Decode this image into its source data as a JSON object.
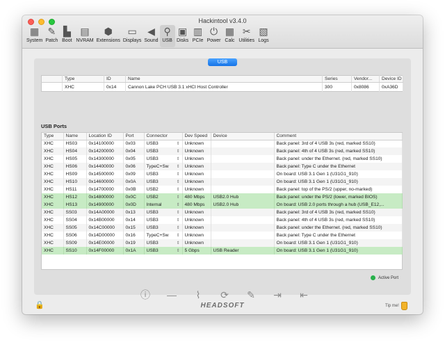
{
  "window": {
    "title": "Hackintool v3.4.0"
  },
  "toolbar": [
    {
      "label": "System",
      "icon": "system-icon"
    },
    {
      "label": "Patch",
      "icon": "patch-icon"
    },
    {
      "label": "Boot",
      "icon": "boot-icon"
    },
    {
      "label": "NVRAM",
      "icon": "nvram-icon"
    },
    {
      "label": "Extensions",
      "icon": "extensions-icon"
    },
    {
      "label": "Displays",
      "icon": "displays-icon"
    },
    {
      "label": "Sound",
      "icon": "sound-icon"
    },
    {
      "label": "USB",
      "icon": "usb-icon",
      "active": true
    },
    {
      "label": "Disks",
      "icon": "disks-icon"
    },
    {
      "label": "PCIe",
      "icon": "pcie-icon"
    },
    {
      "label": "Power",
      "icon": "power-icon"
    },
    {
      "label": "Calc",
      "icon": "calc-icon"
    },
    {
      "label": "Utilities",
      "icon": "utilities-icon"
    },
    {
      "label": "Logs",
      "icon": "logs-icon"
    }
  ],
  "usb_button": "USB",
  "controllers": {
    "columns": [
      "",
      "Type",
      "ID",
      "Name",
      "Series",
      "Vendor...",
      "Device ID"
    ],
    "rows": [
      [
        "",
        "XHC",
        "0x14",
        "Cannon Lake PCH USB 3.1 xHCI Host Controller",
        "300",
        "0x8086",
        "0xA36D"
      ]
    ]
  },
  "ports": {
    "section_title": "USB Ports",
    "columns": [
      "Type",
      "Name",
      "Location ID",
      "Port",
      "Connector",
      "Dev Speed",
      "Device",
      "Comment"
    ],
    "rows": [
      {
        "type": "XHC",
        "name": "HS03",
        "location": "0x14100000",
        "port": "0x03",
        "connector": "USB3",
        "speed": "Unknown",
        "device": "",
        "comment": "Back panel: 3rd of 4 USB 3s (red, marked SS10)",
        "active": false
      },
      {
        "type": "XHC",
        "name": "HS04",
        "location": "0x14200000",
        "port": "0x04",
        "connector": "USB3",
        "speed": "Unknown",
        "device": "",
        "comment": "Back panel: 4th of 4 USB 3s (red, marked SS10)",
        "active": false
      },
      {
        "type": "XHC",
        "name": "HS05",
        "location": "0x14300000",
        "port": "0x05",
        "connector": "USB3",
        "speed": "Unknown",
        "device": "",
        "comment": "Back panel: under the Ethernet. (red, marked SS10)",
        "active": false
      },
      {
        "type": "XHC",
        "name": "HS06",
        "location": "0x14400000",
        "port": "0x06",
        "connector": "TypeC+Sw",
        "speed": "Unknown",
        "device": "",
        "comment": "Back panel: Type C under the Ethernet",
        "active": false
      },
      {
        "type": "XHC",
        "name": "HS09",
        "location": "0x14500000",
        "port": "0x09",
        "connector": "USB3",
        "speed": "Unknown",
        "device": "",
        "comment": "On board: USB 3.1 Gen 1 (U31G1_910)",
        "active": false
      },
      {
        "type": "XHC",
        "name": "HS10",
        "location": "0x14600000",
        "port": "0x0A",
        "connector": "USB3",
        "speed": "Unknown",
        "device": "",
        "comment": "On board: USB 3.1 Gen 1 (U31G1_910)",
        "active": false
      },
      {
        "type": "XHC",
        "name": "HS11",
        "location": "0x14700000",
        "port": "0x0B",
        "connector": "USB2",
        "speed": "Unknown",
        "device": "",
        "comment": "Back panel: top of the PS/2 (upper, no-marked)",
        "active": false
      },
      {
        "type": "XHC",
        "name": "HS12",
        "location": "0x14800000",
        "port": "0x0C",
        "connector": "USB2",
        "speed": "480 Mbps",
        "device": "USB2.0 Hub",
        "comment": "Back panel: under the PS/2 (lower, marked BIOS)",
        "active": true
      },
      {
        "type": "XHC",
        "name": "HS13",
        "location": "0x14900000",
        "port": "0x0D",
        "connector": "Internal",
        "speed": "480 Mbps",
        "device": "USB2.0 Hub",
        "comment": "On board: USB 2.0 ports through a hub (USB_E12,...",
        "active": true
      },
      {
        "type": "XHC",
        "name": "SS03",
        "location": "0x14A00000",
        "port": "0x13",
        "connector": "USB3",
        "speed": "Unknown",
        "device": "",
        "comment": "Back panel: 3rd of 4 USB 3s (red, marked SS10)",
        "active": false
      },
      {
        "type": "XHC",
        "name": "SS04",
        "location": "0x14B00000",
        "port": "0x14",
        "connector": "USB3",
        "speed": "Unknown",
        "device": "",
        "comment": "Back panel: 4th of 4 USB 3s (red, marked SS10)",
        "active": false
      },
      {
        "type": "XHC",
        "name": "SS05",
        "location": "0x14C00000",
        "port": "0x15",
        "connector": "USB3",
        "speed": "Unknown",
        "device": "",
        "comment": "Back panel: under the Ethernet. (red, marked SS10)",
        "active": false
      },
      {
        "type": "XHC",
        "name": "SS06",
        "location": "0x14D00000",
        "port": "0x16",
        "connector": "TypeC+Sw",
        "speed": "Unknown",
        "device": "",
        "comment": "Back panel: Type C under the Ethernet",
        "active": false
      },
      {
        "type": "XHC",
        "name": "SS09",
        "location": "0x14E00000",
        "port": "0x19",
        "connector": "USB3",
        "speed": "Unknown",
        "device": "",
        "comment": "On board: USB 3.1 Gen 1 (U31G1_910)",
        "active": false
      },
      {
        "type": "XHC",
        "name": "SS10",
        "location": "0x14F00000",
        "port": "0x1A",
        "connector": "USB3",
        "speed": "5 Gbps",
        "device": "USB Reader",
        "comment": "On board: USB 3.1 Gen 1 (U31G1_910)",
        "active": true
      }
    ]
  },
  "legend": {
    "label": "Active Port",
    "color": "#27b04a"
  },
  "actions": [
    {
      "name": "info-button",
      "icon": "info-icon",
      "glyph": "ⓘ"
    },
    {
      "name": "remove-button",
      "icon": "minus-icon",
      "glyph": "—"
    },
    {
      "name": "clear-button",
      "icon": "broom-icon",
      "glyph": "⌇"
    },
    {
      "name": "refresh-button",
      "icon": "refresh-icon",
      "glyph": "⟳"
    },
    {
      "name": "edit-button",
      "icon": "pencil-icon",
      "glyph": "✎"
    },
    {
      "name": "import-button",
      "icon": "import-icon",
      "glyph": "⇥"
    },
    {
      "name": "export-button",
      "icon": "export-icon",
      "glyph": "⇤"
    }
  ],
  "footer": {
    "brand": "HEADSOFT",
    "tip_label": "Tip me!"
  },
  "colors": {
    "active_row": "#c7ebc4",
    "accent": "#1673e6"
  }
}
